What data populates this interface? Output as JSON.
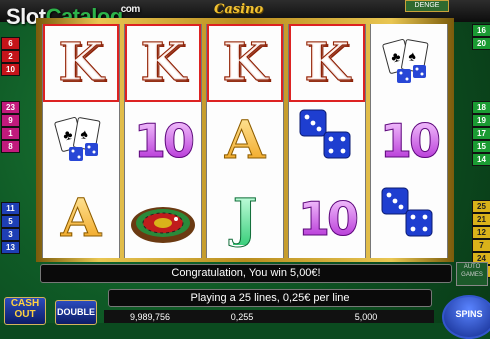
{
  "watermark": {
    "slot": "Slot",
    "catalog": "Catalog",
    "com": "com"
  },
  "logo_text": "Casino",
  "top_button_label": "DENGE",
  "reels": [
    [
      {
        "type": "K",
        "icon": "king-K-letter"
      },
      {
        "type": "cards",
        "icon": "aces-and-dice-icon"
      },
      {
        "type": "A",
        "icon": "ace-A-letter"
      }
    ],
    [
      {
        "type": "K",
        "icon": "king-K-letter"
      },
      {
        "type": "10",
        "icon": "ten-symbol"
      },
      {
        "type": "roulette",
        "icon": "roulette-wheel-icon"
      }
    ],
    [
      {
        "type": "K",
        "icon": "king-K-letter"
      },
      {
        "type": "A",
        "icon": "ace-A-letter"
      },
      {
        "type": "J",
        "icon": "jack-J-letter"
      }
    ],
    [
      {
        "type": "K",
        "icon": "king-K-letter"
      },
      {
        "type": "dice",
        "icon": "dice-icon"
      },
      {
        "type": "10",
        "icon": "ten-symbol"
      }
    ],
    [
      {
        "type": "cards",
        "icon": "aces-and-dice-icon"
      },
      {
        "type": "10",
        "icon": "ten-symbol"
      },
      {
        "type": "dice",
        "icon": "dice-icon"
      }
    ]
  ],
  "symbols": {
    "K": "K",
    "A": "A",
    "J": "J",
    "10": "10"
  },
  "left_lines": {
    "group1": [
      "6",
      "2",
      "10"
    ],
    "group2": [
      "23",
      "9",
      "1",
      "8"
    ],
    "group3": [
      "11",
      "5",
      "3",
      "13"
    ]
  },
  "right_lines": {
    "group1": [
      "16",
      "20"
    ],
    "group2": [
      "18",
      "19",
      "17",
      "15",
      "14"
    ],
    "group3": [
      "25",
      "21",
      "12",
      "7",
      "24",
      "22"
    ]
  },
  "messages": {
    "win": "Congratulation, You win 5,00€!",
    "info": "Playing a 25 lines, 0,25€ per line"
  },
  "bottom_values": [
    "9,989,756",
    "0,255",
    "5,000"
  ],
  "buttons": {
    "cashout": "CASH OUT",
    "double": "DOUBLE",
    "autogames": "AUTO GAMES",
    "spins": "SPINS"
  },
  "colors": {
    "felt": "#0f5a26",
    "frame_gold": "#e9c652",
    "win_red": "#d22222"
  }
}
